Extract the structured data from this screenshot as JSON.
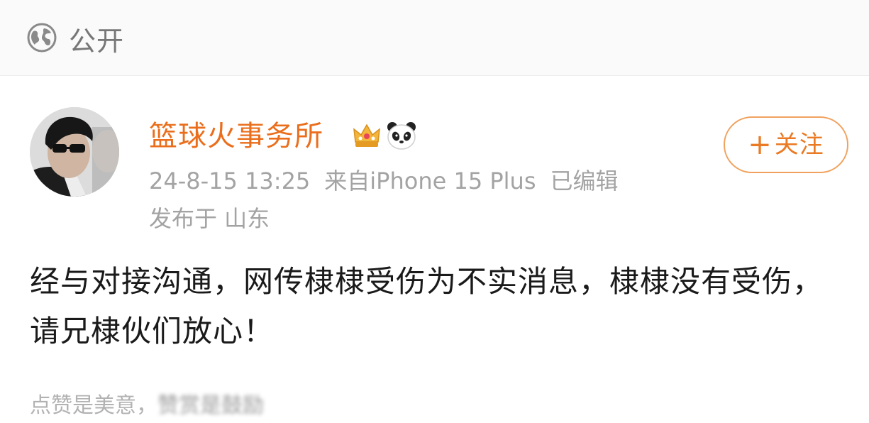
{
  "visibility": {
    "icon": "globe-icon",
    "label": "公开"
  },
  "post": {
    "author": {
      "name": "篮球火事务所",
      "badges": [
        "crown-icon",
        "panda-icon"
      ]
    },
    "follow_button": {
      "plus": "+",
      "label": "关注"
    },
    "meta": {
      "time": "24-8-15 13:25",
      "source": "来自iPhone 15 Plus",
      "edited": "已编辑"
    },
    "location": "发布于 山东",
    "text": "经与对接沟通，网传棣棣受伤为不实消息，棣棣没有受伤，请兄棣伙们放心！"
  },
  "footer": {
    "text": "点赞是美意，",
    "blurred_text": "赞赏是鼓励"
  },
  "colors": {
    "author": "#ea6e1c",
    "follow": "#ea7a24",
    "meta": "#a3a3a3",
    "body": "#1a1a1a"
  }
}
